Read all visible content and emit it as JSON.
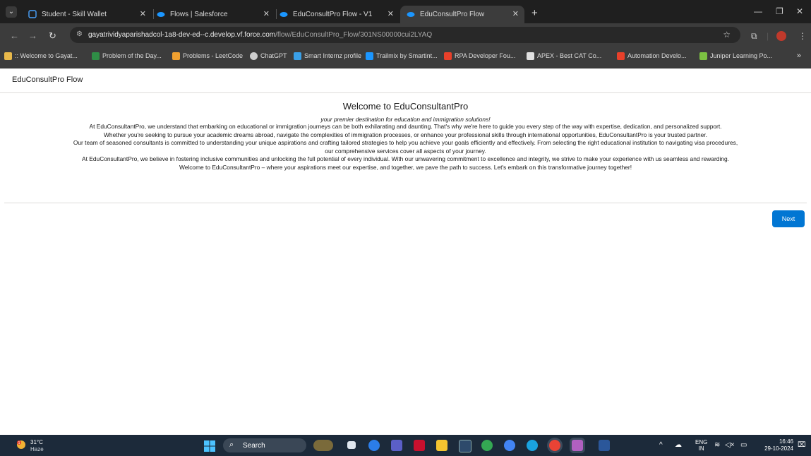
{
  "browser": {
    "tabs": [
      {
        "label": "Student - Skill Wallet",
        "active": false
      },
      {
        "label": "Flows | Salesforce",
        "active": false
      },
      {
        "label": "EduConsultPro Flow - V1",
        "active": false
      },
      {
        "label": "EduConsultPro Flow",
        "active": true
      }
    ],
    "url_host": "gayatrividyaparishadcol-1a8-dev-ed--c.develop.vf.force.com",
    "url_path": "/flow/EduConsultPro_Flow/301NS00000cui2LYAQ",
    "bookmarks": [
      {
        "label": ":: Welcome to Gayat...",
        "icon": "gvp-icon",
        "color": "#e8b84a"
      },
      {
        "label": "Problem of the Day...",
        "icon": "gfg-icon",
        "color": "#2f8d46"
      },
      {
        "label": "Problems - LeetCode",
        "icon": "leetcode-icon",
        "color": "#f0a030"
      },
      {
        "label": "ChatGPT",
        "icon": "chatgpt-icon",
        "color": "#cfcfcf"
      },
      {
        "label": "Smart Internz profile",
        "icon": "smartinternz-icon",
        "color": "#3aa0e8"
      },
      {
        "label": "Trailmix by Smartint...",
        "icon": "trailhead-icon",
        "color": "#1b96ff"
      },
      {
        "label": "RPA Developer Fou...",
        "icon": "uipath-icon",
        "color": "#e8402a"
      },
      {
        "label": "APEX - Best CAT Co...",
        "icon": "apex-icon",
        "color": "#e0e0e0"
      },
      {
        "label": "Automation Develo...",
        "icon": "uipath-icon",
        "color": "#e8402a"
      },
      {
        "label": "Juniper Learning Po...",
        "icon": "juniper-icon",
        "color": "#7cc242"
      }
    ]
  },
  "page": {
    "header_title": "EduConsultPro Flow",
    "welcome_title": "Welcome to EduConsultantPro",
    "tagline": "your premier destination for education and immigration solutions!",
    "paragraphs": [
      "At EduConsultantPro, we understand that embarking on educational or immigration journeys can be both exhilarating and daunting. That's why we're here to guide you every step of the way with expertise, dedication, and personalized support.",
      "Whether you're seeking to pursue your academic dreams abroad, navigate the complexities of immigration processes, or enhance your professional skills through international opportunities, EduConsultantPro is your trusted partner.",
      "Our team of seasoned consultants is committed to understanding your unique aspirations and crafting tailored strategies to help you achieve your goals efficiently and effectively. From selecting the right educational institution to navigating visa procedures,",
      "our comprehensive services cover all aspects of your journey.",
      "At EduConsultantPro, we believe in fostering inclusive communities and unlocking the full potential of every individual. With our unwavering commitment to excellence and integrity, we strive to make your experience with us seamless and rewarding.",
      "Welcome to EduConsultantPro – where your aspirations meet our expertise, and together, we pave the path to success. Let's embark on this transformative journey together!"
    ],
    "next_label": "Next",
    "accent_color": "#0176d3"
  },
  "taskbar": {
    "temperature": "31°C",
    "condition": "Haze",
    "weather_badge": "1",
    "search_label": "Search",
    "lang_top": "ENG",
    "lang_bottom": "IN",
    "time": "16:46",
    "date": "29-10-2024"
  }
}
